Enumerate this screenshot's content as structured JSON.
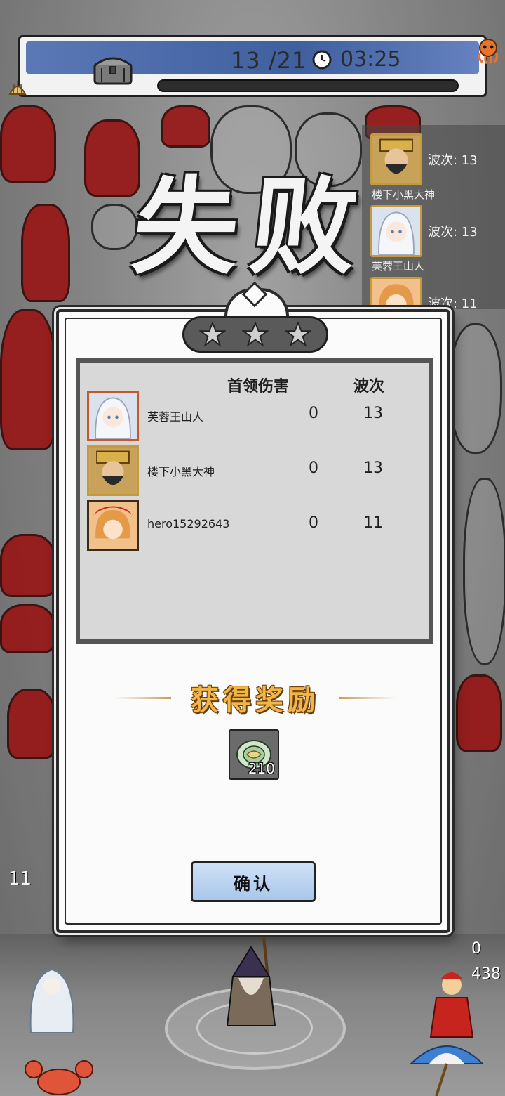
{
  "top_bar": {
    "wave_progress": "13 /21",
    "timer": "03:25",
    "icons": [
      "chest-icon",
      "clock-icon",
      "octopus-icon"
    ]
  },
  "side_ranking": [
    {
      "wave_label": "波次: 13",
      "name": "楼下小黑大神",
      "avatar": "bearded-general-avatar"
    },
    {
      "wave_label": "波次: 13",
      "name": "芙蓉王山人",
      "avatar": "white-hair-girl-avatar"
    },
    {
      "wave_label": "波次: 11",
      "name": "",
      "avatar": "orange-hair-girl-avatar"
    }
  ],
  "fail_title": "失败",
  "dialog": {
    "stars": 3,
    "headers": {
      "damage": "首领伤害",
      "wave": "波次"
    },
    "rows": [
      {
        "name": "芙蓉王山人",
        "damage": "0",
        "wave": "13",
        "avatar": "white-hair-girl-avatar"
      },
      {
        "name": "楼下小黑大神",
        "damage": "0",
        "wave": "13",
        "avatar": "bearded-general-avatar"
      },
      {
        "name": "hero15292643",
        "damage": "0",
        "wave": "11",
        "avatar": "orange-hair-girl-avatar"
      }
    ],
    "reward_title": "获得奖励",
    "reward": {
      "count": "210",
      "icon": "jade-coin-icon"
    },
    "confirm_label": "确认"
  },
  "hud_bottom": {
    "left_value": "11",
    "right_top": "0",
    "right_bottom": "438"
  },
  "colors": {
    "enemy_red": "#b11414",
    "reward_gold": "#f0b646",
    "confirm_blue": "#a9c6ea",
    "top_bar_blue": "#4f6cab"
  }
}
